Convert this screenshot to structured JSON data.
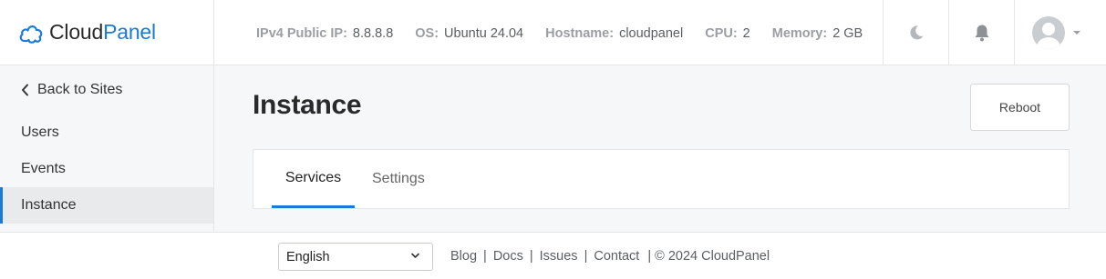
{
  "brand": {
    "part1": "Cloud",
    "part2": "Panel"
  },
  "system_info": [
    {
      "label": "IPv4 Public IP:",
      "value": "8.8.8.8"
    },
    {
      "label": "OS:",
      "value": "Ubuntu 24.04"
    },
    {
      "label": "Hostname:",
      "value": "cloudpanel"
    },
    {
      "label": "CPU:",
      "value": "2"
    },
    {
      "label": "Memory:",
      "value": "2 GB"
    }
  ],
  "sidebar": {
    "back_label": "Back to Sites",
    "items": [
      {
        "label": "Users",
        "active": false
      },
      {
        "label": "Events",
        "active": false
      },
      {
        "label": "Instance",
        "active": true
      }
    ]
  },
  "page": {
    "title": "Instance",
    "reboot_label": "Reboot",
    "tabs": [
      {
        "label": "Services",
        "active": true
      },
      {
        "label": "Settings",
        "active": false
      }
    ]
  },
  "footer": {
    "language": "English",
    "links": [
      "Blog",
      "Docs",
      "Issues",
      "Contact"
    ],
    "copyright": "| © 2024  CloudPanel"
  },
  "colors": {
    "accent": "#1a7bd6",
    "muted": "#9a9ea4"
  },
  "icons": [
    "cloud-logo-icon",
    "moon-icon",
    "bell-icon",
    "user-avatar-icon",
    "chevron-down-icon",
    "chevron-left-icon"
  ]
}
